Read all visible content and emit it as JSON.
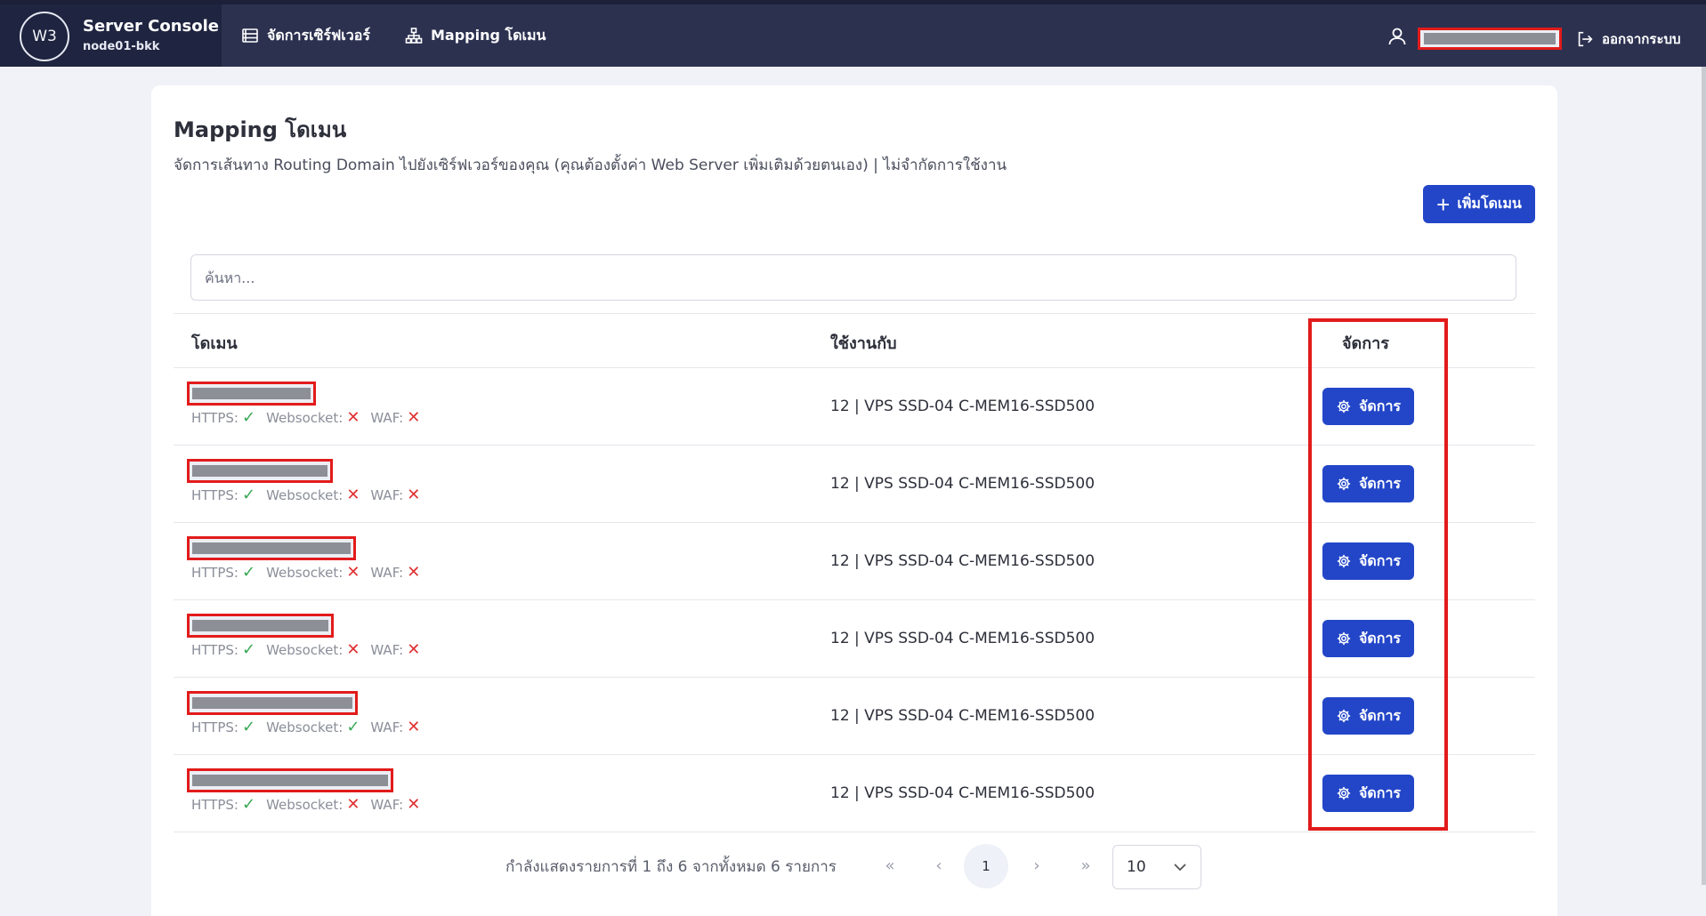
{
  "header": {
    "logo_text": "W3",
    "brand_title": "Server Console",
    "brand_sub": "node01-bkk",
    "nav": [
      {
        "label": "จัดการเซิร์ฟเวอร์",
        "icon": "server-list-icon"
      },
      {
        "label": "Mapping โดเมน",
        "icon": "sitemap-icon"
      }
    ],
    "logout_label": "ออกจากระบบ"
  },
  "page": {
    "title": "Mapping โดเมน",
    "subtitle": "จัดการเส้นทาง Routing Domain ไปยังเซิร์ฟเวอร์ของคุณ (คุณต้องตั้งค่า Web Server เพิ่มเติมด้วยตนเอง) | ไม่จำกัดการใช้งาน",
    "add_button": "เพิ่มโดเมน",
    "search_placeholder": "ค้นหา..."
  },
  "table": {
    "columns": {
      "domain": "โดเมน",
      "used_with": "ใช้งานกับ",
      "manage": "จัดการ"
    },
    "rows": [
      {
        "https": "HTTPS:",
        "websocket": "Websocket:",
        "waf": "WAF:",
        "https_on": true,
        "websocket_on": false,
        "waf_on": false,
        "used_with": "12 | VPS SSD-04 C-MEM16-SSD500",
        "action": "จัดการ"
      },
      {
        "https": "HTTPS:",
        "websocket": "Websocket:",
        "waf": "WAF:",
        "https_on": true,
        "websocket_on": false,
        "waf_on": false,
        "used_with": "12 | VPS SSD-04 C-MEM16-SSD500",
        "action": "จัดการ"
      },
      {
        "https": "HTTPS:",
        "websocket": "Websocket:",
        "waf": "WAF:",
        "https_on": true,
        "websocket_on": false,
        "waf_on": false,
        "used_with": "12 | VPS SSD-04 C-MEM16-SSD500",
        "action": "จัดการ"
      },
      {
        "https": "HTTPS:",
        "websocket": "Websocket:",
        "waf": "WAF:",
        "https_on": true,
        "websocket_on": false,
        "waf_on": false,
        "used_with": "12 | VPS SSD-04 C-MEM16-SSD500",
        "action": "จัดการ"
      },
      {
        "https": "HTTPS:",
        "websocket": "Websocket:",
        "waf": "WAF:",
        "https_on": true,
        "websocket_on": true,
        "waf_on": false,
        "used_with": "12 | VPS SSD-04 C-MEM16-SSD500",
        "action": "จัดการ"
      },
      {
        "https": "HTTPS:",
        "websocket": "Websocket:",
        "waf": "WAF:",
        "https_on": true,
        "websocket_on": false,
        "waf_on": false,
        "used_with": "12 | VPS SSD-04 C-MEM16-SSD500",
        "action": "จัดการ"
      }
    ]
  },
  "pagination": {
    "info": "กำลังแสดงรายการที่ 1 ถึง 6 จากทั้งหมด 6 รายการ",
    "first": "«",
    "prev": "‹",
    "current_page": "1",
    "next": "›",
    "last": "»",
    "page_size": "10"
  },
  "colors": {
    "topbar": "#2c3150",
    "primary": "#2346c8",
    "check": "#3aa855",
    "cross": "#e03131",
    "highlight": "#e21b1b"
  }
}
